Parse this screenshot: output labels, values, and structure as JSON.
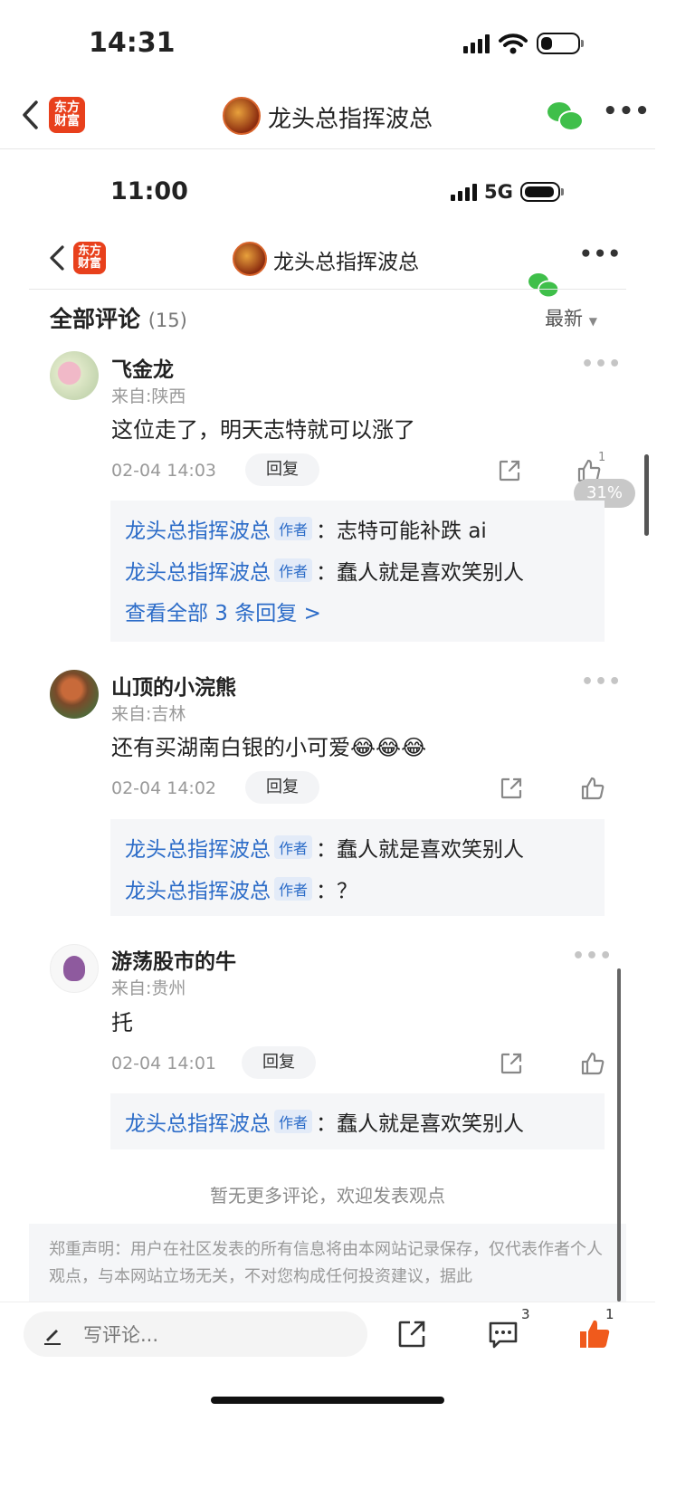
{
  "outer_status": {
    "time": "14:31"
  },
  "outer_nav": {
    "logo_line1": "东方",
    "logo_line2": "财富",
    "title": "龙头总指挥波总"
  },
  "inner_status": {
    "time": "11:00",
    "network": "5G"
  },
  "inner_nav": {
    "logo_line1": "东方",
    "logo_line2": "财富",
    "title": "龙头总指挥波总"
  },
  "comments_header": {
    "title": "全部评论",
    "count": "(15)",
    "sort": "最新"
  },
  "comments": [
    {
      "user": "飞金龙",
      "location": "来自:陕西",
      "text": "这位走了，明天志特就可以涨了",
      "date": "02-04 14:03",
      "reply_label": "回复",
      "like_count": "1",
      "replies": [
        {
          "author": "龙头总指挥波总",
          "badge": "作者",
          "text": "：志特可能补跌 ai"
        },
        {
          "author": "龙头总指挥波总",
          "badge": "作者",
          "text": "：蠢人就是喜欢笑别人"
        }
      ],
      "view_all": "查看全部 3 条回复 >"
    },
    {
      "user": "山顶的小浣熊",
      "location": "来自:吉林",
      "text": "还有买湖南白银的小可爱😂😂😂",
      "date": "02-04 14:02",
      "reply_label": "回复",
      "replies": [
        {
          "author": "龙头总指挥波总",
          "badge": "作者",
          "text": "：蠢人就是喜欢笑别人"
        },
        {
          "author": "龙头总指挥波总",
          "badge": "作者",
          "text": "：？"
        }
      ]
    },
    {
      "user": "游荡股市的牛",
      "location": "来自:贵州",
      "text": "托",
      "date": "02-04 14:01",
      "reply_label": "回复",
      "replies": [
        {
          "author": "龙头总指挥波总",
          "badge": "作者",
          "text": "：蠢人就是喜欢笑别人"
        }
      ]
    }
  ],
  "scroll_percent": "31%",
  "no_more": "暂无更多评论，欢迎发表观点",
  "disclaimer": "郑重声明：用户在社区发表的所有信息将由本网站记录保存，仅代表作者个人观点，与本网站立场无关，不对您构成任何投资建议，据此",
  "bottom_bar": {
    "placeholder": "写评论...",
    "comment_count": "3",
    "like_count": "1"
  },
  "colors": {
    "brand": "#e8401c",
    "link": "#2c6cc8",
    "wechat": "#3fbf4a",
    "liked": "#f05a1c"
  }
}
